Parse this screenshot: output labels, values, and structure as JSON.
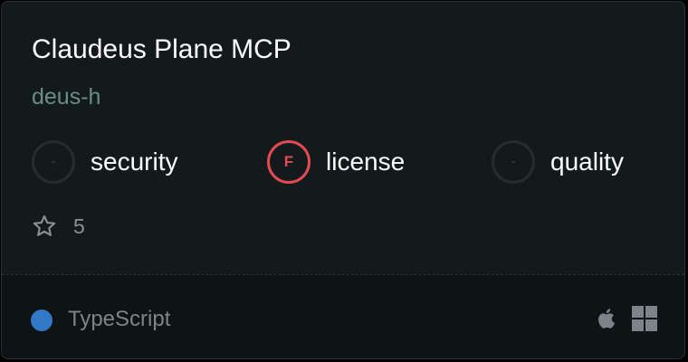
{
  "card": {
    "title": "Claudeus Plane MCP",
    "author": "deus-h",
    "scores": [
      {
        "grade": "-",
        "label": "security"
      },
      {
        "grade": "F",
        "label": "license"
      },
      {
        "grade": "-",
        "label": "quality"
      }
    ],
    "stars": "5",
    "language": {
      "name": "TypeScript",
      "color": "#3178c6"
    },
    "platform_icons": [
      "apple-icon",
      "windows-icon"
    ],
    "colors": {
      "background": "#131a1c",
      "grade_f": "#e44a4f",
      "author": "#6f8c82"
    }
  }
}
